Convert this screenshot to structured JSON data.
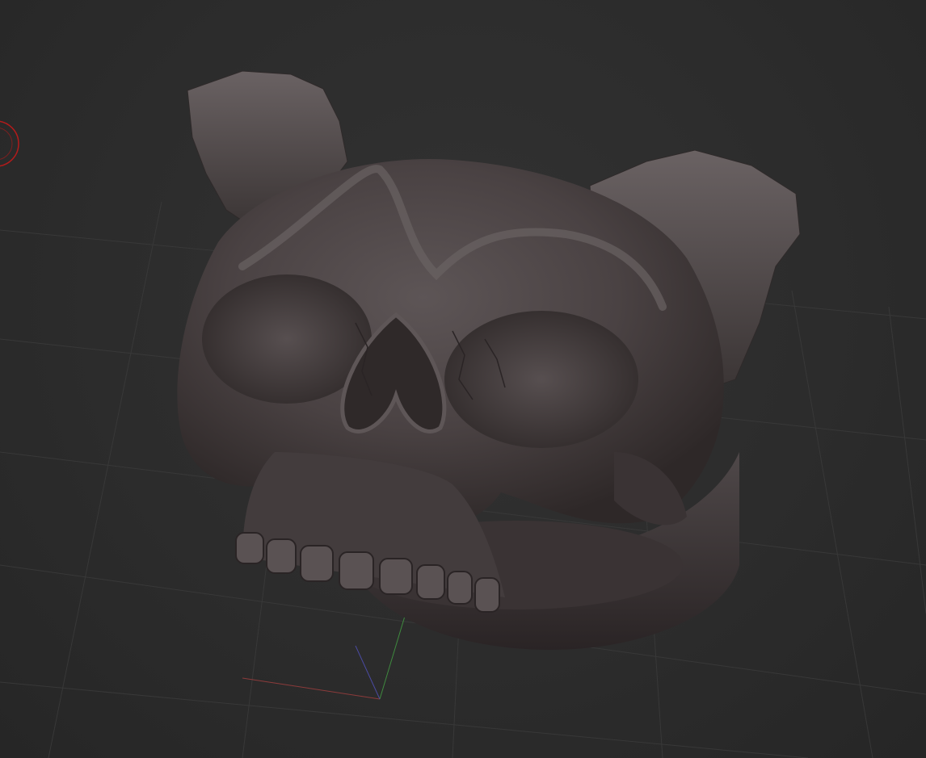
{
  "viewport": {
    "background_color": "#2b2b2b",
    "grid_color": "#3a3a3a",
    "model_color": "#4a4344",
    "axis_colors": {
      "x": "#8c3b3b",
      "y": "#3f8a3f",
      "z": "#4a4aa0"
    },
    "navigation_gizmo_color": "#b31b1b",
    "model_name": "skull-ring-with-horns"
  }
}
